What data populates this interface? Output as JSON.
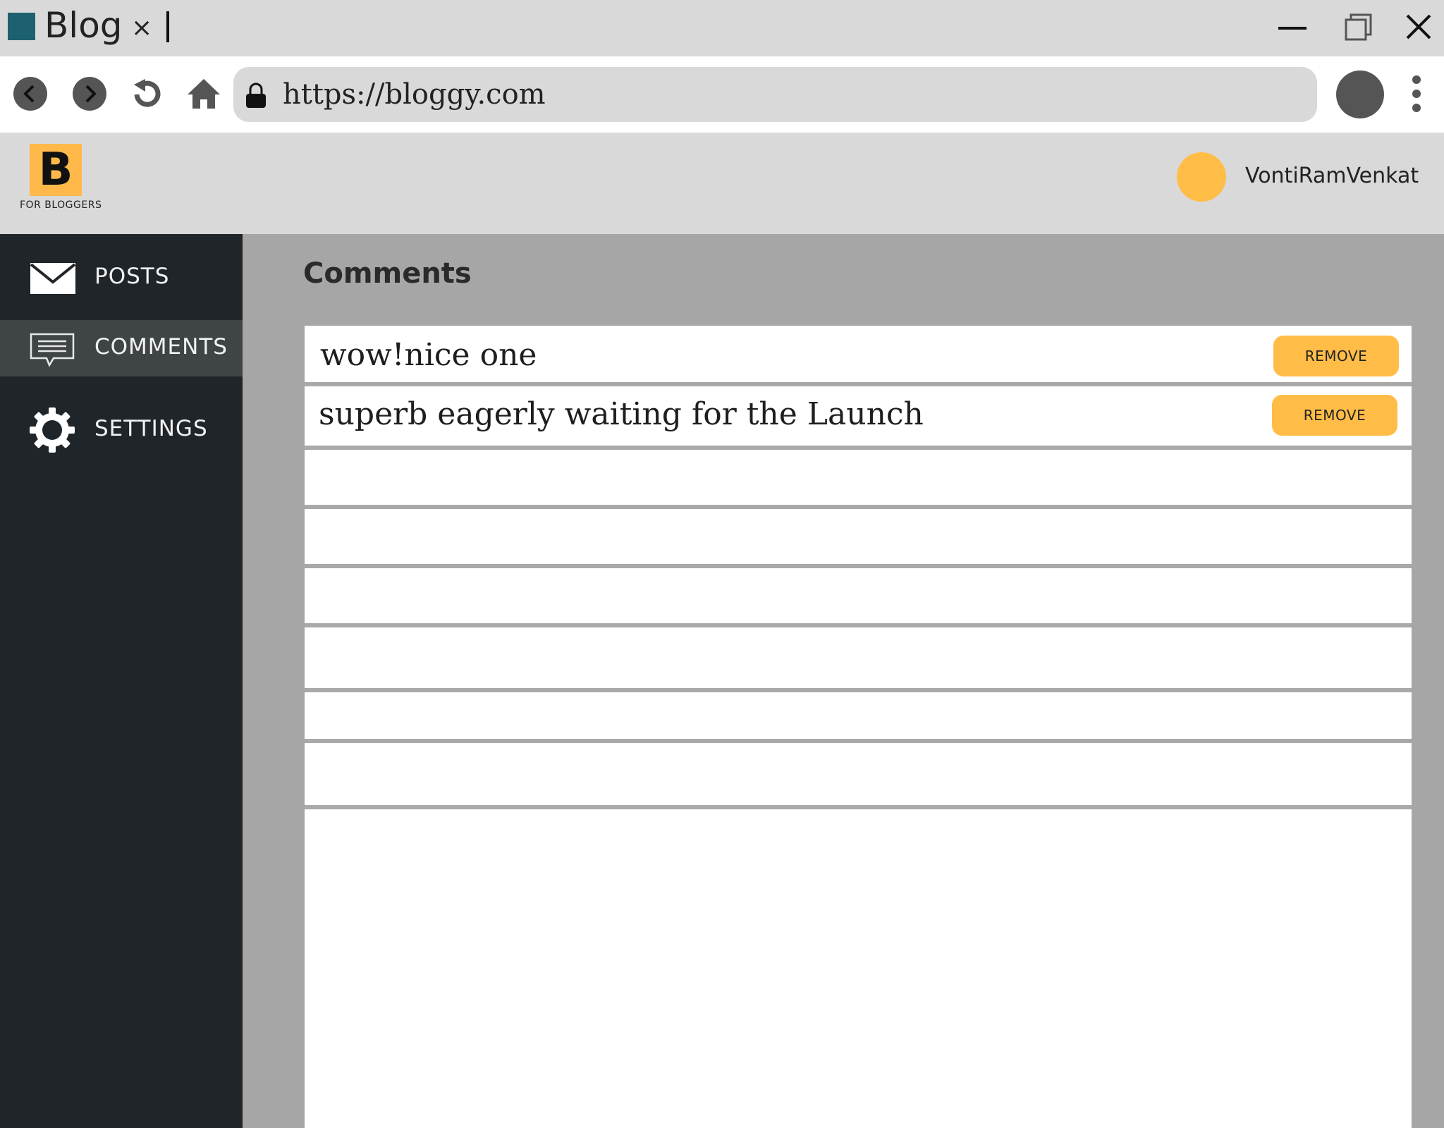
{
  "browser": {
    "tab_title": "Blog",
    "tab_close": "×",
    "url": "https://bloggy.com"
  },
  "app": {
    "logo_letter": "B",
    "logo_tagline": "FOR BLOGGERS",
    "user_name": "VontiRamVenkat"
  },
  "sidebar": {
    "items": [
      {
        "label": "POSTS",
        "icon": "envelope-icon",
        "active": false
      },
      {
        "label": "COMMENTS",
        "icon": "comment-icon",
        "active": true
      },
      {
        "label": "SETTINGS",
        "icon": "gear-icon",
        "active": false
      }
    ]
  },
  "main": {
    "title": "Comments",
    "comments": [
      {
        "text": "wow!nice one",
        "action": "REMOVE"
      },
      {
        "text": "superb eagerly waiting for the Launch",
        "action": "REMOVE"
      }
    ]
  },
  "colors": {
    "accent": "#ffbd48",
    "sidebar_bg": "#1f2529",
    "sidebar_active": "#3f4547",
    "content_bg": "#a6a6a6",
    "favicon": "#1d6170"
  }
}
